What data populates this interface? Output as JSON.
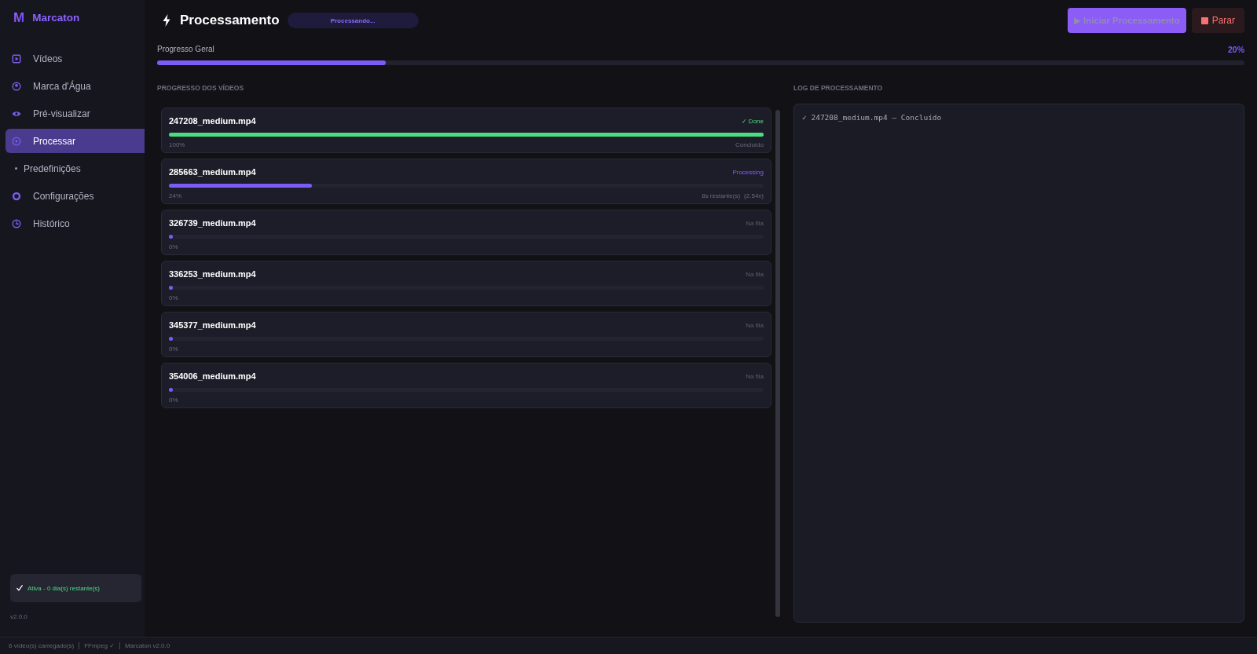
{
  "sidebar": {
    "logo_mark": "M",
    "app_name": "Marcaton",
    "items": [
      {
        "label": "Vídeos",
        "kind": "icon",
        "selected": false
      },
      {
        "label": "Marca d'Água",
        "kind": "icon",
        "selected": false
      },
      {
        "label": "Pré-visualizar",
        "kind": "icon",
        "selected": false
      },
      {
        "label": "Processar",
        "kind": "icon",
        "selected": true
      },
      {
        "label": "Predefinições",
        "kind": "bullet",
        "selected": false
      },
      {
        "label": "Configurações",
        "kind": "icon",
        "selected": false
      },
      {
        "label": "Histórico",
        "kind": "icon",
        "selected": false
      }
    ],
    "license": {
      "text": "Ativa - 0 dia(s) restante(s)"
    },
    "version": "v2.0.0"
  },
  "header": {
    "title": "Processamento",
    "badge": "Processando...",
    "buttons": [
      {
        "label": "▶ Iniciar Processamento",
        "kind": "primary",
        "disabled": true
      },
      {
        "label": "Parar",
        "kind": "stop",
        "disabled": false
      }
    ]
  },
  "overall_progress": {
    "label": "Progresso Geral",
    "reading": "20%",
    "level": 0.21
  },
  "videos": {
    "heading": "PROGRESSO DOS VÍDEOS",
    "items": [
      {
        "name": "247208_medium.mp4",
        "kind": "done",
        "status_label": "✓ Done",
        "level": 1,
        "percent": "100%",
        "details": [
          "Concluído"
        ]
      },
      {
        "name": "285663_medium.mp4",
        "kind": "processing",
        "status_label": "Processing",
        "level": 0.24,
        "percent": "24%",
        "details": [
          "8s restante(s)",
          "(2.54x)"
        ]
      },
      {
        "name": "326739_medium.mp4",
        "kind": "queued",
        "status_label": "Na fila",
        "level": 0,
        "percent": "0%"
      },
      {
        "name": "336253_medium.mp4",
        "kind": "queued",
        "status_label": "Na fila",
        "level": 0,
        "percent": "0%"
      },
      {
        "name": "345377_medium.mp4",
        "kind": "queued",
        "status_label": "Na fila",
        "level": 0,
        "percent": "0%"
      },
      {
        "name": "354006_medium.mp4",
        "kind": "queued",
        "status_label": "Na fila",
        "level": 0,
        "percent": "0%"
      }
    ]
  },
  "log": {
    "heading": "LOG DE PROCESSAMENTO",
    "lines": [
      "✓ 247208_medium.mp4 — Concluído"
    ]
  },
  "status_bar": {
    "items": [
      "6 vídeo(s) carregado(s)",
      "FFmpeg ✓",
      "Marcaton v2.0.0"
    ]
  }
}
